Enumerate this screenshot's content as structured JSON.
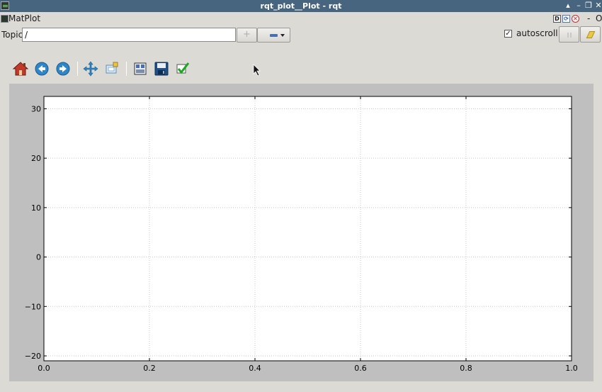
{
  "window": {
    "title": "rqt_plot__Plot - rqt"
  },
  "dock": {
    "title": "MatPlot",
    "help_label": "D",
    "minimize_label": "-",
    "close_label": "O"
  },
  "topic": {
    "label": "Topic",
    "value": "/",
    "add_label": "+"
  },
  "autoscroll": {
    "label": "autoscroll",
    "checked": true
  },
  "toolbar": {
    "icons": [
      "home-icon",
      "back-icon",
      "forward-icon",
      "pan-icon",
      "zoom-icon",
      "configure-subplots-icon",
      "save-icon",
      "edit-axis-icon"
    ]
  },
  "colors": {
    "titlebar": "#48657f",
    "figure_bg": "#bfbfbf",
    "plot_bg": "#ffffff"
  },
  "chart_data": {
    "type": "line",
    "title": "",
    "xlabel": "",
    "ylabel": "",
    "xlim": [
      0.0,
      1.0
    ],
    "ylim": [
      -21,
      32.5
    ],
    "xticks": [
      "0.0",
      "0.2",
      "0.4",
      "0.6",
      "0.8",
      "1.0"
    ],
    "xtick_values": [
      0.0,
      0.2,
      0.4,
      0.6,
      0.8,
      1.0
    ],
    "yticks": [
      "30",
      "20",
      "10",
      "0",
      "−10",
      "−20"
    ],
    "ytick_values": [
      30,
      20,
      10,
      0,
      -10,
      -20
    ],
    "grid": true,
    "series": []
  }
}
